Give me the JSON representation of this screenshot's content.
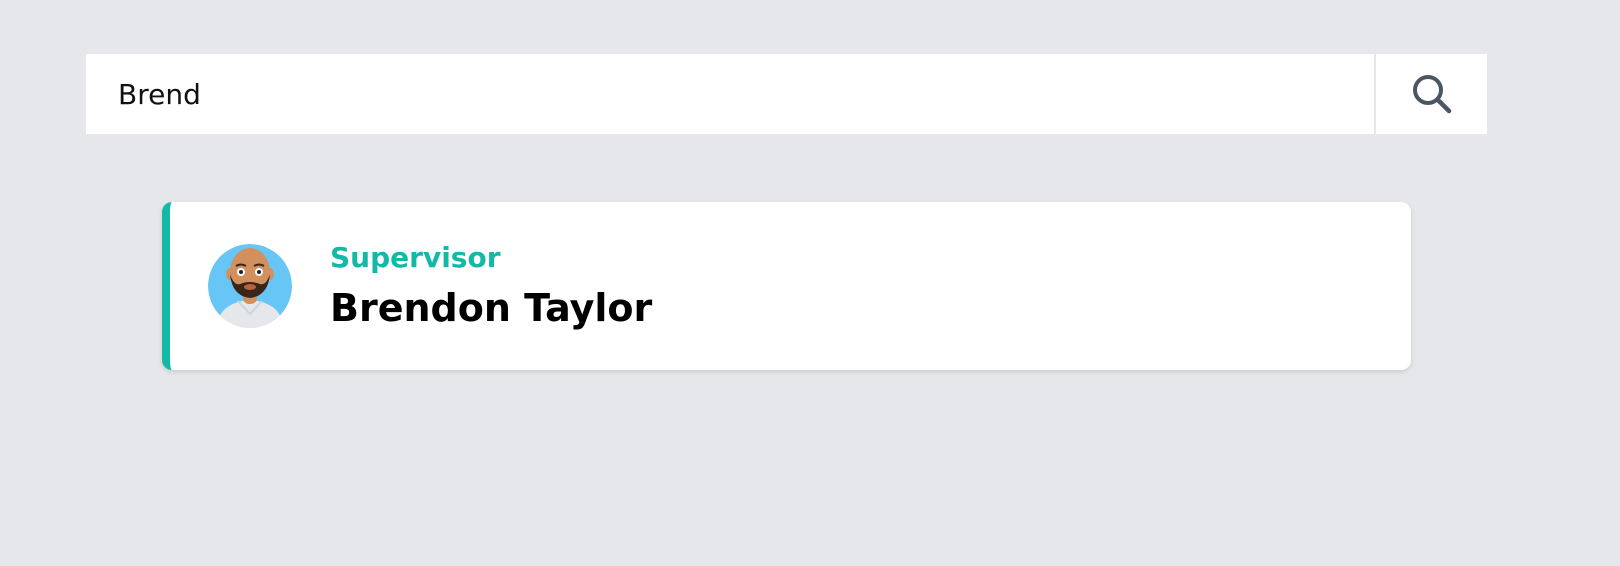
{
  "search": {
    "value": "Brend",
    "button_icon": "search-icon"
  },
  "result": {
    "role": "Supervisor",
    "name": "Brendon Taylor",
    "avatar_icon": "person-avatar-icon"
  },
  "colors": {
    "background": "#e5e7eb",
    "accent": "#14b8a6",
    "icon": "#4b5563",
    "avatar_bg": "#67c6f5"
  }
}
